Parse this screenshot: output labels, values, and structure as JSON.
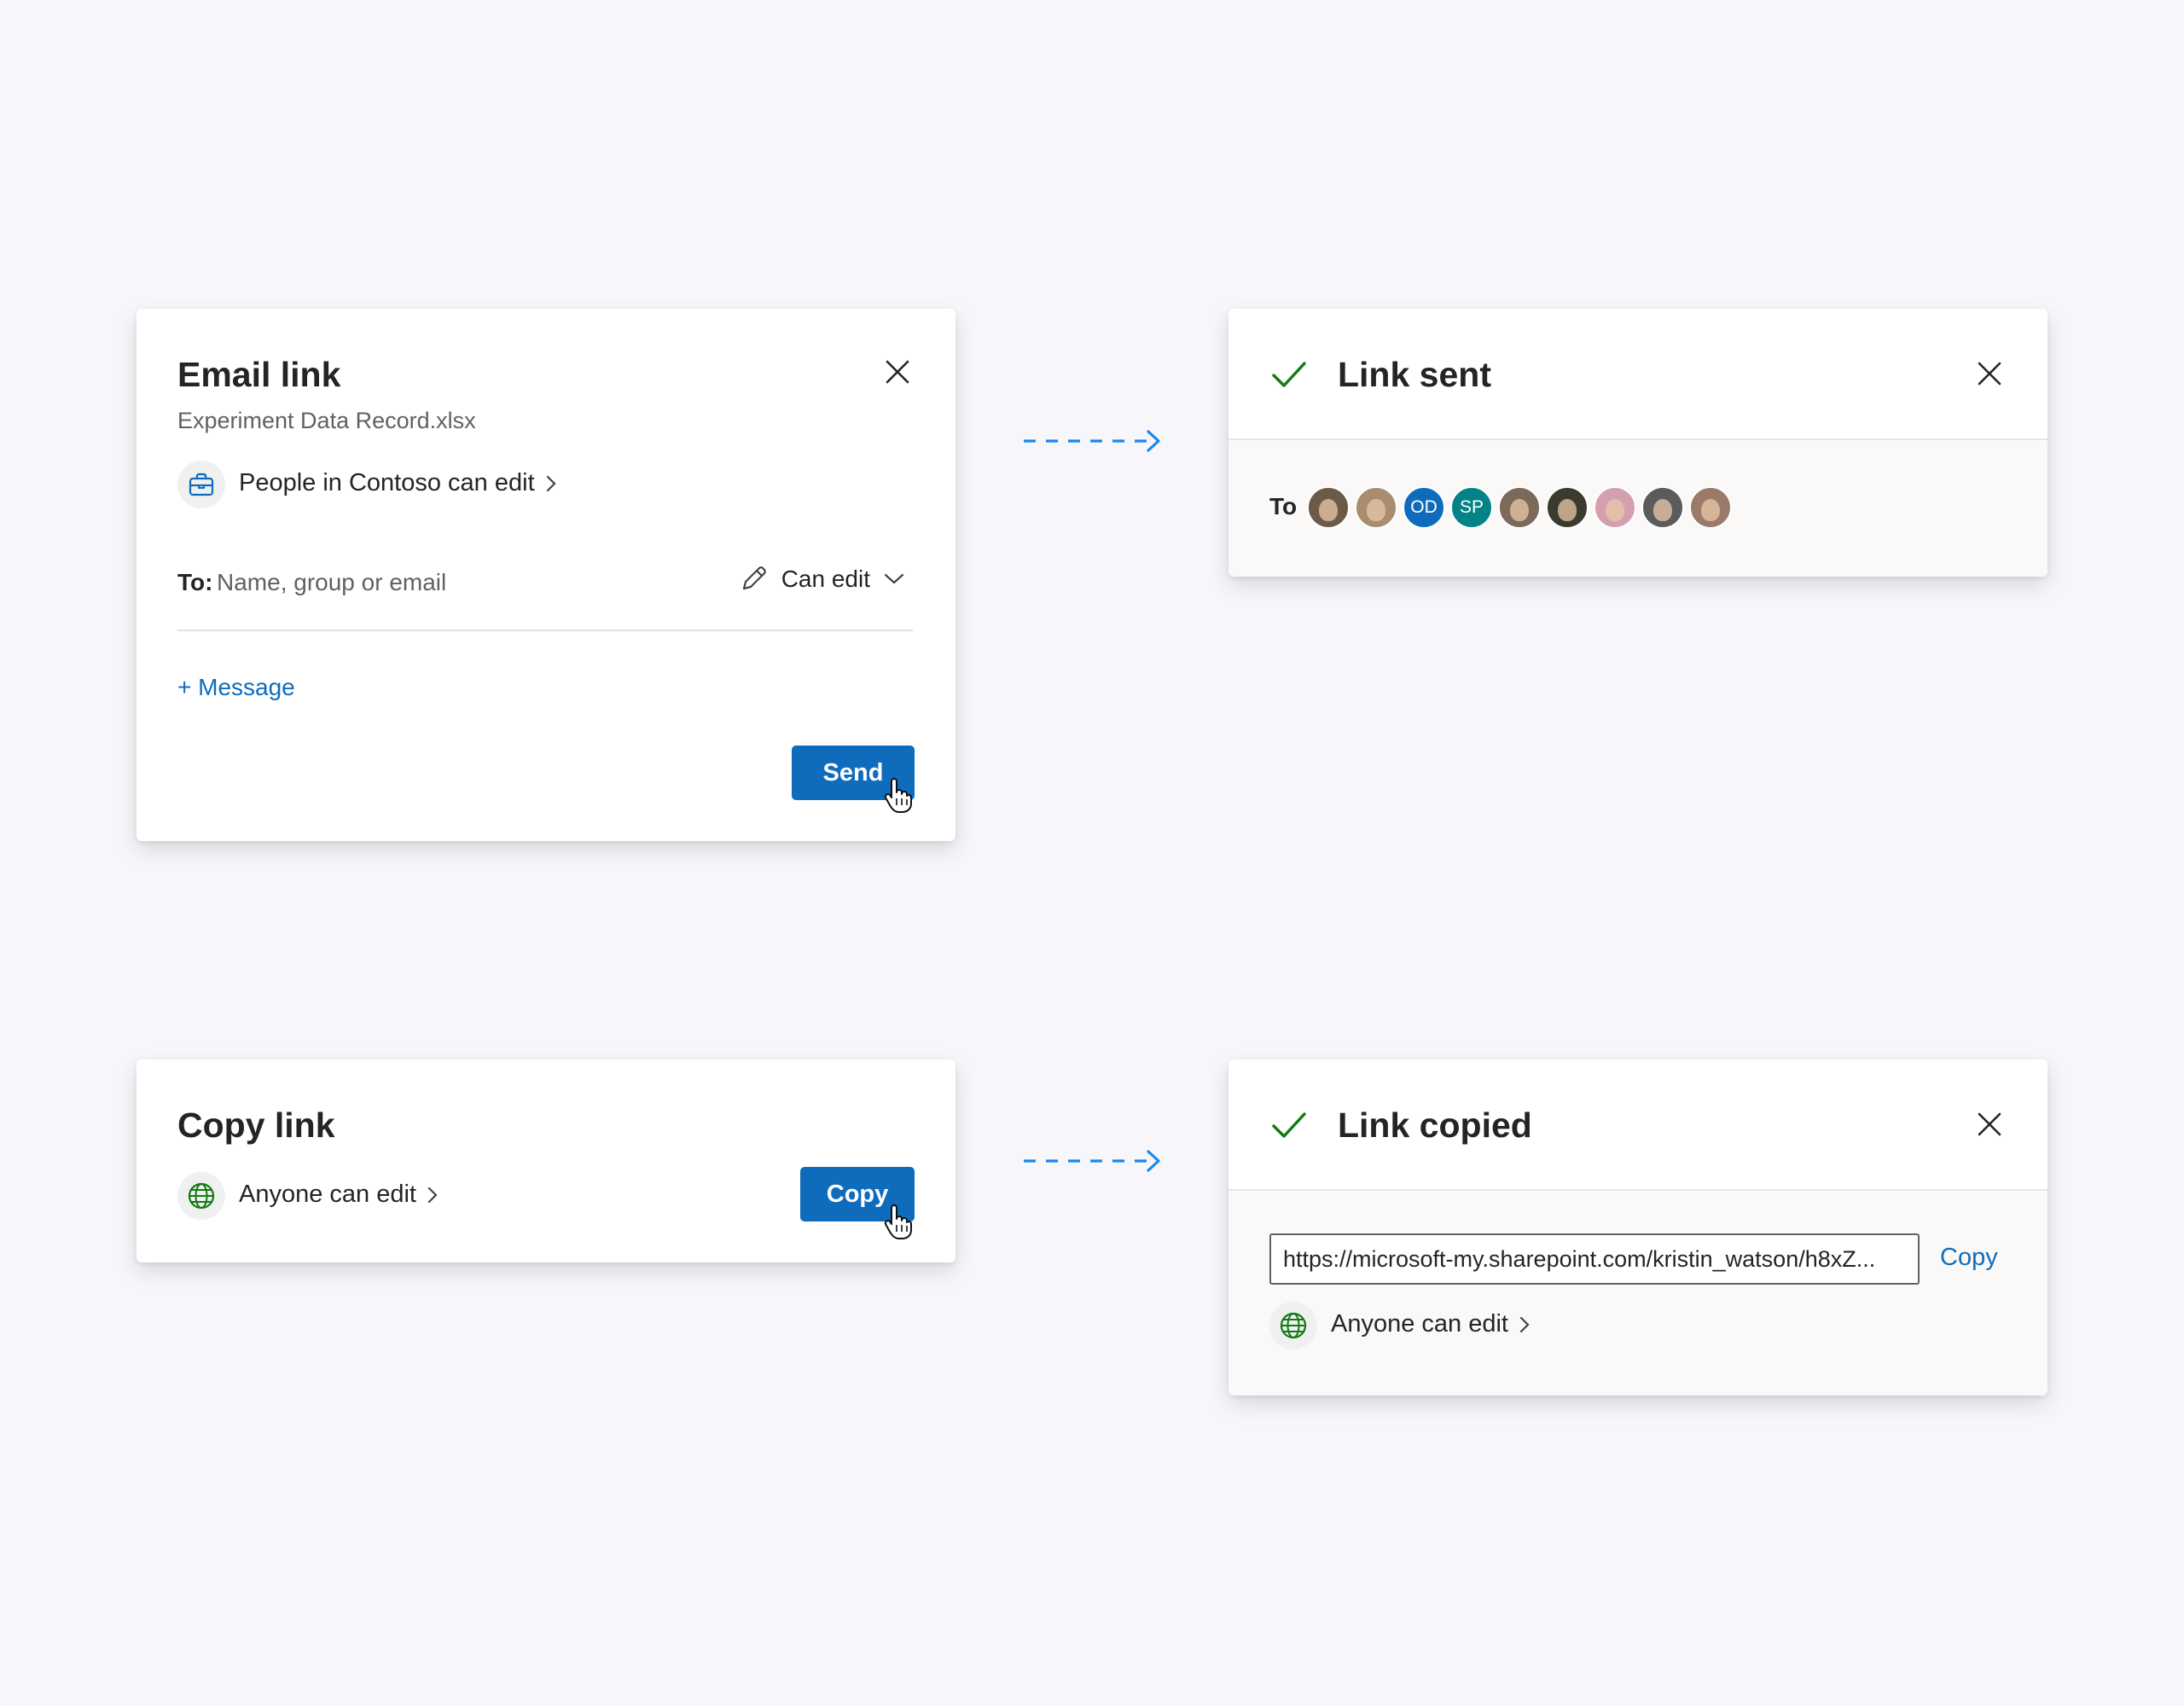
{
  "email_card": {
    "title": "Email link",
    "filename": "Experiment Data Record.xlsx",
    "permission_label": "People in Contoso can edit",
    "to_label": "To:",
    "to_placeholder": "Name, group or email",
    "can_edit_label": "Can edit",
    "message_link": "+ Message",
    "send_label": "Send"
  },
  "sent_card": {
    "title": "Link sent",
    "to_label": "To",
    "recipients": [
      {
        "kind": "photo",
        "color": "#6b5a48"
      },
      {
        "kind": "photo",
        "color": "#a88d70"
      },
      {
        "kind": "initials",
        "initials": "OD",
        "color": "#0f6cbd"
      },
      {
        "kind": "initials",
        "initials": "SP",
        "color": "#038387"
      },
      {
        "kind": "photo",
        "color": "#7a6a5a"
      },
      {
        "kind": "photo",
        "color": "#3a3a2e"
      },
      {
        "kind": "photo",
        "color": "#d4a0b0"
      },
      {
        "kind": "photo",
        "color": "#5b5b5b"
      },
      {
        "kind": "photo",
        "color": "#9a7a68"
      }
    ]
  },
  "copy_card": {
    "title": "Copy link",
    "permission_label": "Anyone can edit",
    "copy_label": "Copy"
  },
  "copied_card": {
    "title": "Link copied",
    "url": "https://microsoft-my.sharepoint.com/kristin_watson/h8xZ...",
    "copy_label": "Copy",
    "permission_label": "Anyone can edit"
  },
  "colors": {
    "accent": "#0f6cbd",
    "link": "#0f6cbd",
    "success": "#107c10",
    "arrow": "#1a86f0",
    "panel_bg": "#faf9f8"
  },
  "icons": {
    "close": "close-icon",
    "check": "checkmark-icon",
    "briefcase": "briefcase-icon",
    "globe": "globe-icon",
    "pencil": "pencil-icon",
    "chevron_down": "chevron-down-icon",
    "chevron_right": "chevron-right-icon"
  }
}
